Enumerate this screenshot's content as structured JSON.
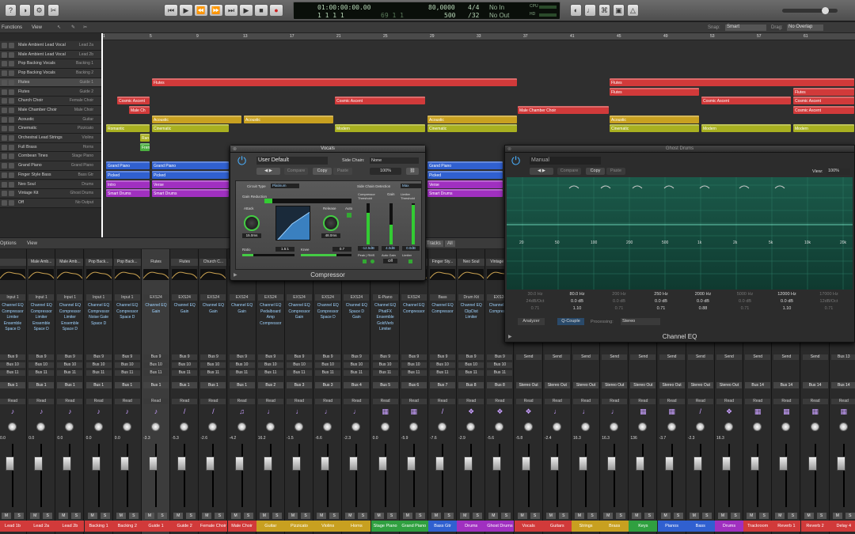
{
  "control_bar": {
    "lcd_time": "01:00:00:00.00",
    "lcd_bars": "1   1   1      1",
    "lcd_aux": "69  1  1",
    "lcd_tempo": "80,0000",
    "lcd_sig": "4/4",
    "lcd_no_in": "No In",
    "lcd_bpm": "500",
    "lcd_div": "/32",
    "lcd_no_out": "No Out",
    "cpu": "CPU",
    "hd": "HD"
  },
  "track_header": {
    "functions": "Functions",
    "view": "View",
    "snap_label": "Snap:",
    "snap_value": "Smart",
    "drag_label": "Drag:",
    "drag_value": "No Overlap"
  },
  "ruler_numbers": [
    "1",
    "5",
    "9",
    "13",
    "17",
    "21",
    "25",
    "29",
    "33",
    "37",
    "41",
    "45",
    "49",
    "53",
    "57",
    "61"
  ],
  "tracks": [
    {
      "name": "Male Ambient Lead Vocal",
      "sub": "Lead 2a"
    },
    {
      "name": "Male Ambient Lead Vocal",
      "sub": "Lead 2b"
    },
    {
      "name": "Pop Backing Vocals",
      "sub": "Backing 1"
    },
    {
      "name": "Pop Backing Vocals",
      "sub": "Backing 2"
    },
    {
      "name": "Flutes",
      "sub": "Guide 1"
    },
    {
      "name": "Flutes",
      "sub": "Guide 2"
    },
    {
      "name": "Church Choir",
      "sub": "Female Choir"
    },
    {
      "name": "Male Chamber Choir",
      "sub": "Male Choir"
    },
    {
      "name": "Acoustic",
      "sub": "Guitar"
    },
    {
      "name": "Cinematic",
      "sub": "Pizzicato"
    },
    {
      "name": "Orchestral Lead Strings",
      "sub": "Violins"
    },
    {
      "name": "Full Brass",
      "sub": "Horns"
    },
    {
      "name": "Cornbean Tines",
      "sub": "Stage Piano"
    },
    {
      "name": "Grand Piano",
      "sub": "Grand Piano"
    },
    {
      "name": "Finger Style Bass",
      "sub": "Bass Gtr"
    },
    {
      "name": "Neo Soul",
      "sub": "Drums"
    },
    {
      "name": "Vintage Kit",
      "sub": "Ghost Drums"
    },
    {
      "name": "Off",
      "sub": "No Output"
    }
  ],
  "regions": {
    "flutes": "Flutes",
    "cosmic": "Cosmic Ascent",
    "male_chamber": "Male Chamber Choir",
    "male_ch": "Male Ch",
    "acoustic": "Acoustic",
    "romantic": "Romantic",
    "cinematic": "Cinematic",
    "modern": "Modern",
    "ran": "Ran",
    "fren": "Fren",
    "grand_piano": "Grand Piano",
    "picked": "Picked",
    "intro": "Intro",
    "verse": "Verse",
    "smart_drums": "Smart Drums"
  },
  "mixer_header": {
    "options": "Options",
    "view": "View",
    "tracks": "Tracks",
    "all": "All"
  },
  "compressor": {
    "title": "Vocals",
    "preset": "User Default",
    "sidechain_label": "Side Chain:",
    "sidechain_value": "None",
    "compare": "Compare",
    "copy": "Copy",
    "paste": "Paste",
    "zoom": "100%",
    "circuit_label": "Circuit Type",
    "circuit_value": "Platinum",
    "sc_detect": "Side Chain Detection",
    "sc_value": "Max",
    "gain_reduction": "Gain Reduction",
    "attack": "Attack",
    "attack_val": "15.0ms",
    "release": "Release",
    "release_val": "48.0ms",
    "auto": "Auto",
    "ratio": "Ratio",
    "ratio_val": "1.5:1",
    "knee": "Knee",
    "knee_val": "0.7",
    "comp_thresh": "Compressor Threshold",
    "gain": "Gain",
    "limiter_thresh": "Limiter Threshold",
    "thresh_val": "-12.5dB",
    "gain_val": "4.0dB",
    "limit_val": "0.0dB",
    "peak_rms": "Peak | RMS",
    "auto_gain": "Auto Gain",
    "auto_gain_val": "Off",
    "limiter": "Limiter",
    "name": "Compressor"
  },
  "channel_eq": {
    "title": "Ghost Drums",
    "preset": "Manual",
    "compare": "Compare",
    "copy": "Copy",
    "paste": "Paste",
    "view_label": "View:",
    "view_value": "100%",
    "freq_labels": [
      "20",
      "50",
      "100",
      "200",
      "500",
      "1k",
      "2k",
      "5k",
      "10k",
      "20k"
    ],
    "bands": [
      {
        "freq": "30.0 Hz",
        "gain": "24dB/Oct",
        "q": "0.71"
      },
      {
        "freq": "80.0 Hz",
        "gain": "0.0 dB",
        "q": "1.10"
      },
      {
        "freq": "200 Hz",
        "gain": "0.0 dB",
        "q": "0.71"
      },
      {
        "freq": "250 Hz",
        "gain": "0.0 dB",
        "q": "0.71"
      },
      {
        "freq": "2000 Hz",
        "gain": "0.0 dB",
        "q": "0.88"
      },
      {
        "freq": "5000 Hz",
        "gain": "0.0 dB",
        "q": "0.71"
      },
      {
        "freq": "12000 Hz",
        "gain": "0.0 dB",
        "q": "1.10"
      },
      {
        "freq": "17000 Hz",
        "gain": "12dB/Oct",
        "q": "0.71"
      }
    ],
    "analyzer": "Analyzer",
    "qcouple": "Q-Couple",
    "processing_label": "Processing:",
    "processing_value": "Stereo",
    "name": "Channel EQ"
  },
  "strips": [
    {
      "label": "",
      "eq": true,
      "input": "Input 1",
      "plugins": [
        "Channel EQ",
        "Compressor",
        "Limiter",
        "Ensemble",
        "Space D"
      ],
      "sends": [
        "Bus 9",
        "Bus 10",
        "Bus 11"
      ],
      "out": "Bus 1",
      "vol": "0.0",
      "icon": "♪",
      "name": "Lead 1b",
      "color": "#d13a3a"
    },
    {
      "label": "Male Amb...",
      "eq": true,
      "input": "Input 1",
      "plugins": [
        "Channel EQ",
        "Compressor",
        "Limiter",
        "Ensemble",
        "Space D"
      ],
      "sends": [
        "Bus 9",
        "Bus 10",
        "Bus 11"
      ],
      "out": "Bus 1",
      "vol": "0.0",
      "icon": "♪",
      "name": "Lead 2a",
      "color": "#d13a3a"
    },
    {
      "label": "Male Amb...",
      "eq": true,
      "input": "Input 1",
      "plugins": [
        "Channel EQ",
        "Compressor",
        "Limiter",
        "Ensemble",
        "Space D"
      ],
      "sends": [
        "Bus 9",
        "Bus 10",
        "Bus 11"
      ],
      "out": "Bus 1",
      "vol": "0.0",
      "icon": "♪",
      "name": "Lead 2b",
      "color": "#d13a3a"
    },
    {
      "label": "Pop Back...",
      "eq": true,
      "input": "Input 1",
      "plugins": [
        "Channel EQ",
        "Compressor",
        "Noise Gate",
        "Space D"
      ],
      "sends": [
        "Bus 9",
        "Bus 10",
        "Bus 11"
      ],
      "out": "Bus 1",
      "vol": "0.0",
      "icon": "♪",
      "name": "Backing 1",
      "color": "#d13a3a"
    },
    {
      "label": "Pop Back...",
      "eq": true,
      "input": "Input 1",
      "plugins": [
        "Channel EQ",
        "Compressor",
        "Space D"
      ],
      "sends": [
        "Bus 9",
        "Bus 10",
        "Bus 11"
      ],
      "out": "Bus 1",
      "vol": "0.0",
      "icon": "♪",
      "name": "Backing 2",
      "color": "#d13a3a"
    },
    {
      "label": "Flutes",
      "eq": true,
      "input": "EXS24",
      "plugins": [
        "Channel EQ",
        "Gain"
      ],
      "sends": [
        "Bus 9",
        "Bus 10",
        "Bus 11"
      ],
      "out": "Bus 1",
      "vol": "-3.3",
      "icon": "♪",
      "name": "Guide 1",
      "color": "#d13a3a",
      "selected": true
    },
    {
      "label": "Flutes",
      "eq": true,
      "input": "EXS24",
      "plugins": [
        "Channel EQ",
        "Gain"
      ],
      "sends": [
        "Bus 9",
        "Bus 10",
        "Bus 11"
      ],
      "out": "Bus 1",
      "vol": "-5.3",
      "icon": "/",
      "name": "Guide 2",
      "color": "#d13a3a"
    },
    {
      "label": "Church C...",
      "eq": true,
      "input": "EXS24",
      "plugins": [
        "Channel EQ",
        "Gain"
      ],
      "sends": [
        "Bus 9",
        "Bus 10",
        "Bus 11"
      ],
      "out": "Bus 1",
      "vol": "-2.6",
      "icon": "/",
      "name": "Female Choir",
      "color": "#d13a3a"
    },
    {
      "label": "Male Choir",
      "eq": true,
      "input": "EXS24",
      "plugins": [
        "Channel EQ",
        "Gain"
      ],
      "sends": [
        "Bus 9",
        "Bus 10",
        "Bus 11"
      ],
      "out": "Bus 1",
      "vol": "-4.2",
      "icon": "♫",
      "name": "Male Choir",
      "color": "#d13a3a"
    },
    {
      "label": "",
      "eq": true,
      "input": "EXS24",
      "plugins": [
        "Channel EQ",
        "Pedalboard",
        "Amp",
        "Compressor"
      ],
      "sends": [
        "Bus 9",
        "Bus 10",
        "Bus 11"
      ],
      "out": "Bus 2",
      "vol": "16.2",
      "icon": "♩",
      "name": "Guitar",
      "color": "#c8a020"
    },
    {
      "label": "",
      "eq": true,
      "input": "EXS24",
      "plugins": [
        "Channel EQ",
        "Compressor",
        "Gain"
      ],
      "sends": [
        "Bus 9",
        "Bus 10",
        "Bus 11"
      ],
      "out": "Bus 3",
      "vol": "-1.5",
      "icon": "♩",
      "name": "Pizzicato",
      "color": "#c8a020"
    },
    {
      "label": "",
      "eq": true,
      "input": "EXS24",
      "plugins": [
        "Channel EQ",
        "Compressor",
        "Space D"
      ],
      "sends": [
        "Bus 9",
        "Bus 10",
        "Bus 11"
      ],
      "out": "Bus 3",
      "vol": "-6.6",
      "icon": "♩",
      "name": "Violins",
      "color": "#c8a020"
    },
    {
      "label": "",
      "eq": true,
      "input": "EXS24",
      "plugins": [
        "Channel EQ",
        "Space D",
        "Gain"
      ],
      "sends": [
        "Bus 9",
        "Bus 10",
        "Bus 11"
      ],
      "out": "Bus 4",
      "vol": "-2.3",
      "icon": "♩",
      "name": "Horns",
      "color": "#c8a020"
    },
    {
      "label": "",
      "eq": true,
      "input": "E-Piano",
      "plugins": [
        "Channel EQ",
        "PhatFX",
        "Ensemble",
        "GoldVerb",
        "Limiter"
      ],
      "sends": [
        "Bus 9",
        "Bus 10",
        "Bus 11"
      ],
      "out": "Bus 5",
      "vol": "0.0",
      "icon": "▦",
      "name": "Stage Piano",
      "color": "#30a040"
    },
    {
      "label": "",
      "eq": true,
      "input": "EXS24",
      "plugins": [
        "Channel EQ",
        "Compressor"
      ],
      "sends": [
        "Bus 9",
        "Bus 10",
        "Bus 11"
      ],
      "out": "Bus 6",
      "vol": "-5.9",
      "icon": "▦",
      "name": "Grand Piano",
      "color": "#30a040"
    },
    {
      "label": "Finger Sty...",
      "eq": true,
      "input": "Bass",
      "plugins": [
        "Channel EQ",
        "Compressor"
      ],
      "sends": [
        "Bus 9",
        "Bus 10",
        "Bus 11"
      ],
      "out": "Bus 7",
      "vol": "-7.6",
      "icon": "/",
      "name": "Bass Gtr",
      "color": "#3060d0"
    },
    {
      "label": "Neo Soul",
      "eq": true,
      "input": "Drum Kit",
      "plugins": [
        "Channel EQ",
        "ClipDist",
        "Limiter"
      ],
      "sends": [
        "Bus 9",
        "Bus 10",
        "Bus 11"
      ],
      "out": "Bus 8",
      "vol": "-2.9",
      "icon": "❖",
      "name": "Drums",
      "color": "#a030c0"
    },
    {
      "label": "Vintage Kit",
      "eq": true,
      "input": "EXS24",
      "plugins": [
        "Channel EQ",
        "Compressor"
      ],
      "sends": [
        "Bus 9",
        "Bus 10",
        "Bus 11"
      ],
      "out": "Bus 8",
      "vol": "-5.6",
      "icon": "❖",
      "name": "Ghost Drums",
      "color": "#a030c0"
    },
    {
      "label": "",
      "eq": false,
      "input": "",
      "plugins": [],
      "sends": [
        "Send"
      ],
      "out": "Stereo Out",
      "vol": "-5.8",
      "icon": "❖",
      "name": "Vocals",
      "color": "#d13a3a"
    },
    {
      "label": "",
      "eq": false,
      "input": "",
      "plugins": [],
      "sends": [
        "Send"
      ],
      "out": "Stereo Out",
      "vol": "-2.4",
      "icon": "♩",
      "name": "Guitars",
      "color": "#d13a3a"
    },
    {
      "label": "",
      "eq": false,
      "input": "",
      "plugins": [],
      "sends": [
        "Send"
      ],
      "out": "Stereo Out",
      "vol": "16.3",
      "icon": "♩",
      "name": "Strings",
      "color": "#c8a020"
    },
    {
      "label": "",
      "eq": false,
      "input": "",
      "plugins": [],
      "sends": [
        "Send"
      ],
      "out": "Stereo Out",
      "vol": "16.3",
      "icon": "♩",
      "name": "Brass",
      "color": "#c8a020"
    },
    {
      "label": "",
      "eq": false,
      "input": "",
      "plugins": [],
      "sends": [
        "Send"
      ],
      "out": "Stereo Out",
      "vol": "136",
      "icon": "▦",
      "name": "Keys",
      "color": "#30a040"
    },
    {
      "label": "",
      "eq": false,
      "input": "",
      "plugins": [],
      "sends": [
        "Send"
      ],
      "out": "Stereo Out",
      "vol": "-3.7",
      "icon": "▦",
      "name": "Pianos",
      "color": "#3060d0"
    },
    {
      "label": "",
      "eq": false,
      "input": "",
      "plugins": [],
      "sends": [
        "Send"
      ],
      "out": "Stereo Out",
      "vol": "-2.3",
      "icon": "/",
      "name": "Bass",
      "color": "#3060d0"
    },
    {
      "label": "",
      "eq": false,
      "input": "",
      "plugins": [],
      "sends": [
        "Send"
      ],
      "out": "Stereo Out",
      "vol": "16.3",
      "icon": "❖",
      "name": "Drums",
      "color": "#a030c0"
    },
    {
      "label": "",
      "eq": false,
      "input": "",
      "plugins": [],
      "sends": [
        "Send"
      ],
      "out": "Bus 14",
      "vol": "",
      "icon": "▦",
      "name": "Trackroom",
      "color": "#d13a3a"
    },
    {
      "label": "",
      "eq": false,
      "input": "",
      "plugins": [],
      "sends": [
        "Send"
      ],
      "out": "Bus 14",
      "vol": "",
      "icon": "▦",
      "name": "Reverb 1",
      "color": "#d13a3a"
    },
    {
      "label": "",
      "eq": false,
      "input": "",
      "plugins": [],
      "sends": [
        "Send"
      ],
      "out": "Bus 14",
      "vol": "",
      "icon": "▦",
      "name": "Reverb 2",
      "color": "#d13a3a"
    },
    {
      "label": "",
      "eq": false,
      "input": "",
      "plugins": [],
      "sends": [
        "Bus 13"
      ],
      "out": "Bus 14",
      "vol": "",
      "icon": "▦",
      "name": "Delay 4",
      "color": "#d13a3a"
    }
  ]
}
